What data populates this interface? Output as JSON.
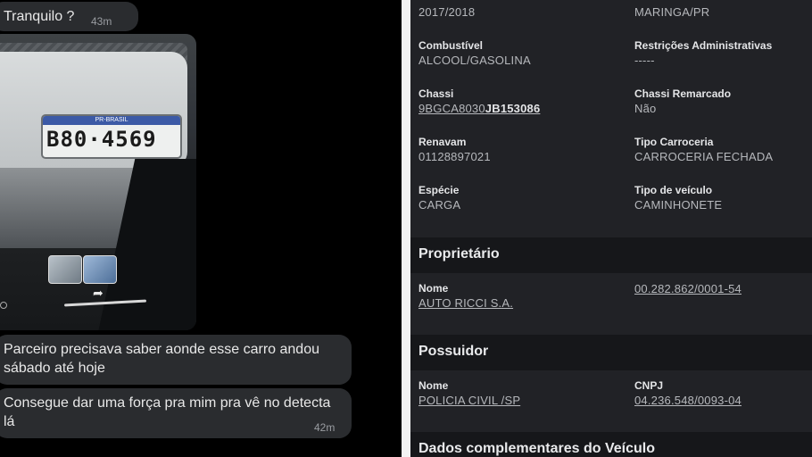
{
  "chat": {
    "messages": [
      {
        "text": "Tranquilo ?",
        "time": "43m"
      },
      {
        "text": "Parceiro precisava saber aonde esse carro andou sábado até hoje"
      },
      {
        "text": "Consegue dar uma força pra mim pra vê no detecta lá",
        "time": "42m"
      }
    ],
    "photo": {
      "plate_top": "PR-BRASIL",
      "plate_number": "B80·4569",
      "share_icon": "share-arrow-icon"
    }
  },
  "vehicle": {
    "partial_row": {
      "left_value": "2017/2018",
      "right_value": "MARINGA/PR"
    },
    "fields": [
      {
        "label": "Combustível",
        "value": "ALCOOL/GASOLINA"
      },
      {
        "label": "Restrições Administrativas",
        "value": "-----"
      },
      {
        "label": "Chassi",
        "value_prefix": "9BGCA8030",
        "value_suffix": "JB153086"
      },
      {
        "label": "Chassi Remarcado",
        "value": "Não"
      },
      {
        "label": "Renavam",
        "value": "01128897021"
      },
      {
        "label": "Tipo Carroceria",
        "value": "CARROCERIA FECHADA"
      },
      {
        "label": "Espécie",
        "value": "CARGA"
      },
      {
        "label": "Tipo de veículo",
        "value": "CAMINHONETE"
      }
    ],
    "proprietario": {
      "title": "Proprietário",
      "nome_label": "Nome",
      "nome_value": "AUTO RICCI S.A.",
      "doc_value": "00.282.862/0001-54"
    },
    "possuidor": {
      "title": "Possuidor",
      "nome_label": "Nome",
      "nome_value": "POLICIA CIVIL /SP",
      "cnpj_label": "CNPJ",
      "cnpj_value": "04.236.548/0093-04"
    },
    "dados_title": "Dados complementares do Veículo"
  },
  "colors": {
    "panel_bg": "#212226",
    "section_bg": "#16171a",
    "bubble_bg": "#2a2c2f"
  }
}
